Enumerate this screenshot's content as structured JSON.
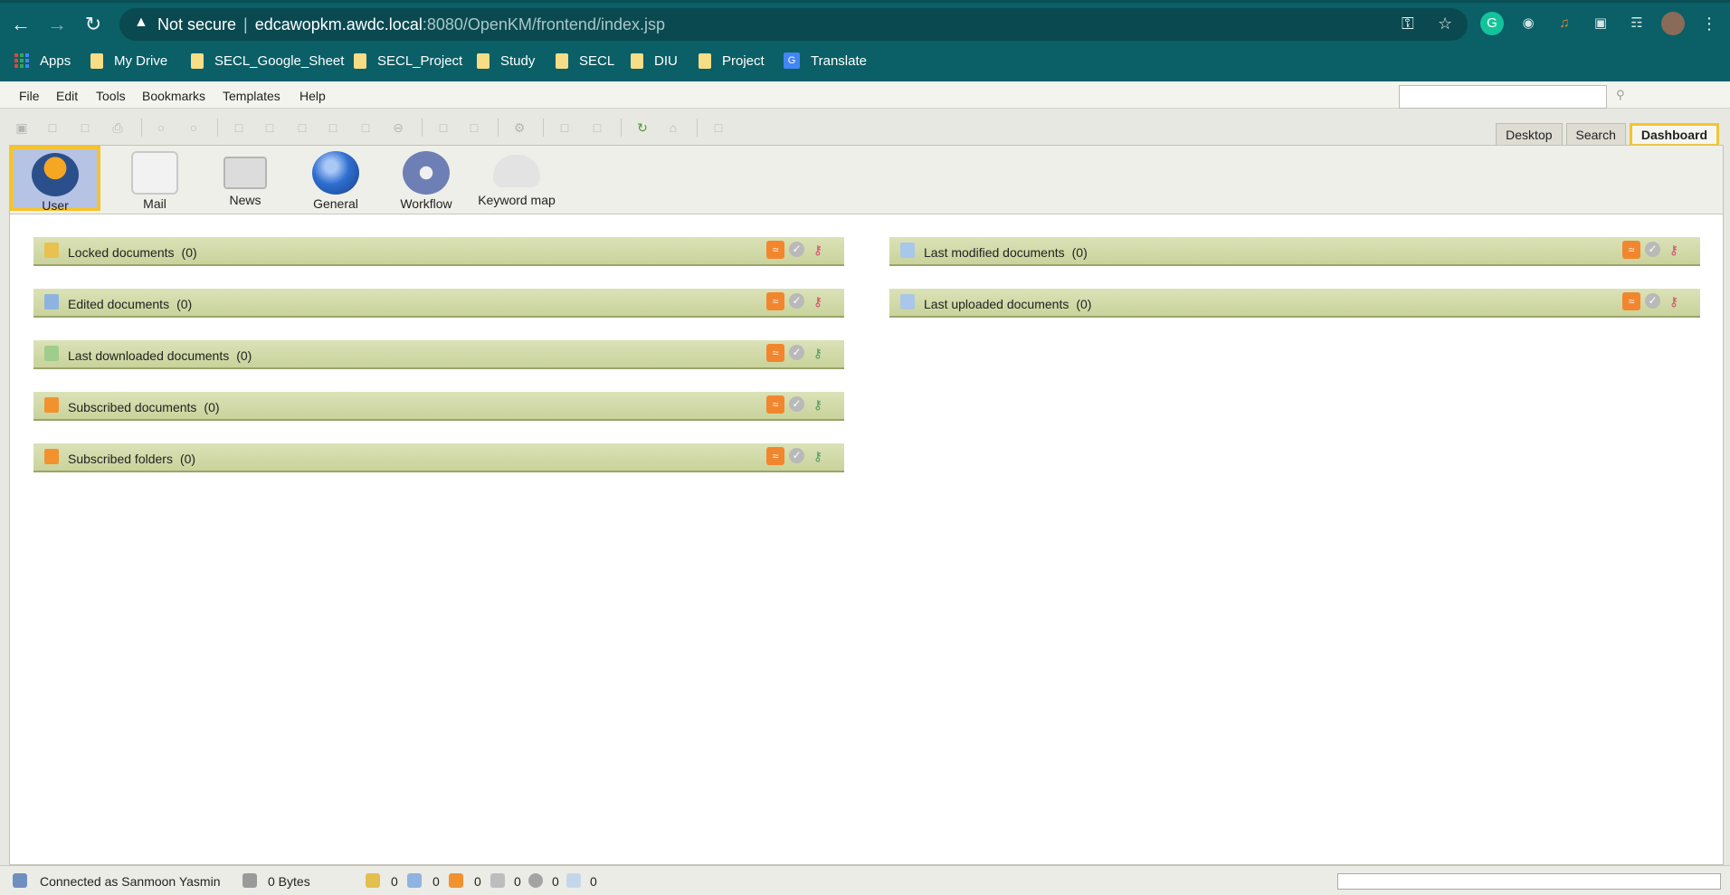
{
  "browser": {
    "warning_label": "Not secure",
    "url_host": "edcawopkm.awdc.local",
    "url_path": ":8080/OpenKM/frontend/index.jsp",
    "bookmarks": [
      "Apps",
      "My Drive",
      "SECL_Google_Sheet",
      "SECL_Project",
      "Study",
      "SECL",
      "DIU",
      "Project",
      "Translate"
    ]
  },
  "menu": {
    "items": [
      "File",
      "Edit",
      "Tools",
      "Bookmarks",
      "Templates",
      "Help"
    ],
    "search_placeholder": ""
  },
  "tabs": [
    "Desktop",
    "Search",
    "Dashboard"
  ],
  "iconbar": {
    "items": [
      "User",
      "Mail",
      "News",
      "General",
      "Workflow",
      "Keyword map"
    ]
  },
  "widgets": {
    "left": [
      {
        "title": "Locked documents",
        "count": "(0)"
      },
      {
        "title": "Edited documents",
        "count": "(0)"
      },
      {
        "title": "Last downloaded documents",
        "count": "(0)"
      },
      {
        "title": "Subscribed documents",
        "count": "(0)"
      },
      {
        "title": "Subscribed folders",
        "count": "(0)"
      }
    ],
    "right": [
      {
        "title": "Last modified documents",
        "count": "(0)"
      },
      {
        "title": "Last uploaded documents",
        "count": "(0)"
      }
    ]
  },
  "status": {
    "connected": "Connected as Sanmoon Yasmin",
    "size": "0 Bytes",
    "counters": [
      "0",
      "0",
      "0",
      "0",
      "0",
      "0"
    ]
  },
  "colors": {
    "chrome": "#0b5f67",
    "highlight": "#f4c430",
    "widget_header": "#cfd8a6"
  }
}
